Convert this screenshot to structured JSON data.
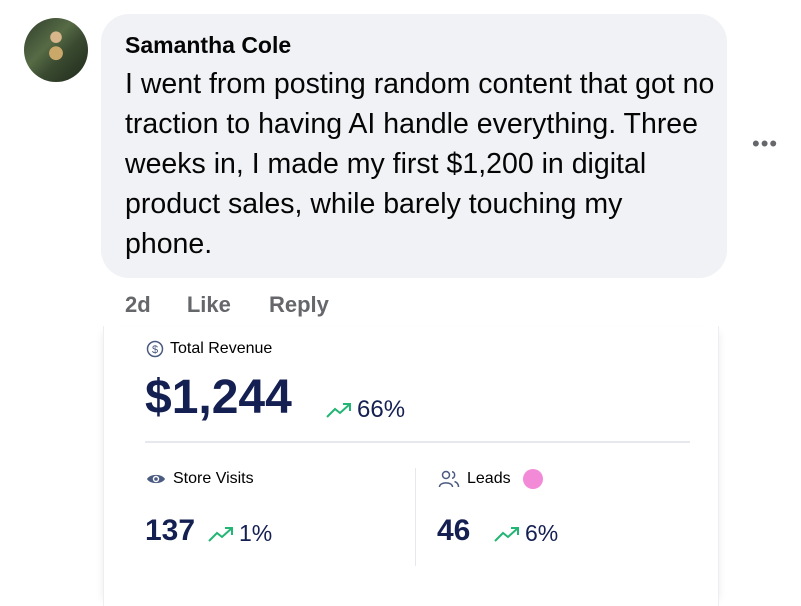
{
  "comment": {
    "author": "Samantha Cole",
    "text": "I went from posting random content that got no traction to having AI handle everything. Three weeks in, I made my first $1,200 in digital product sales, while barely touching my phone.",
    "age": "2d",
    "like_label": "Like",
    "reply_label": "Reply",
    "more_label": "•••"
  },
  "stats": {
    "revenue": {
      "label": "Total Revenue",
      "value": "$1,244",
      "change": "66%"
    },
    "visits": {
      "label": "Store Visits",
      "value": "137",
      "change": "1%"
    },
    "leads": {
      "label": "Leads",
      "value": "46",
      "change": "6%"
    }
  },
  "colors": {
    "trend_up": "#22b573",
    "value_navy": "#141f52",
    "leads_dot": "#f28ad8"
  }
}
